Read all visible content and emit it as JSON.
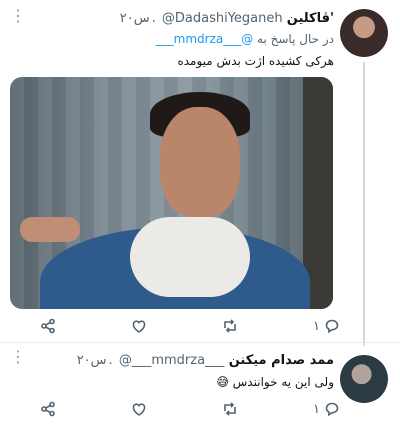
{
  "tweets": [
    {
      "name": "ڤاکلین'",
      "handle": "@DadashiYeganeh",
      "time": "۲۰س",
      "reply_prefix": "در حال پاسخ به",
      "reply_to": "@___mmdrza___",
      "text": "هرکی کشیده اژت بدش میومده",
      "actions": {
        "reply_count": "۱"
      }
    },
    {
      "name": "ممد صدام میکنن",
      "handle": "@___mmdrza___",
      "time": "۲۰س",
      "text": "ولی این یه خوانندس",
      "emoji": "😅",
      "actions": {
        "reply_count": "۱"
      }
    }
  ],
  "more_label": "⋮",
  "colors": {
    "accent": "#1d9bf0",
    "muted": "#536471",
    "divider": "#e6ecf0"
  },
  "icons": [
    "share-icon",
    "like-icon",
    "retweet-icon",
    "reply-icon",
    "more-icon"
  ]
}
